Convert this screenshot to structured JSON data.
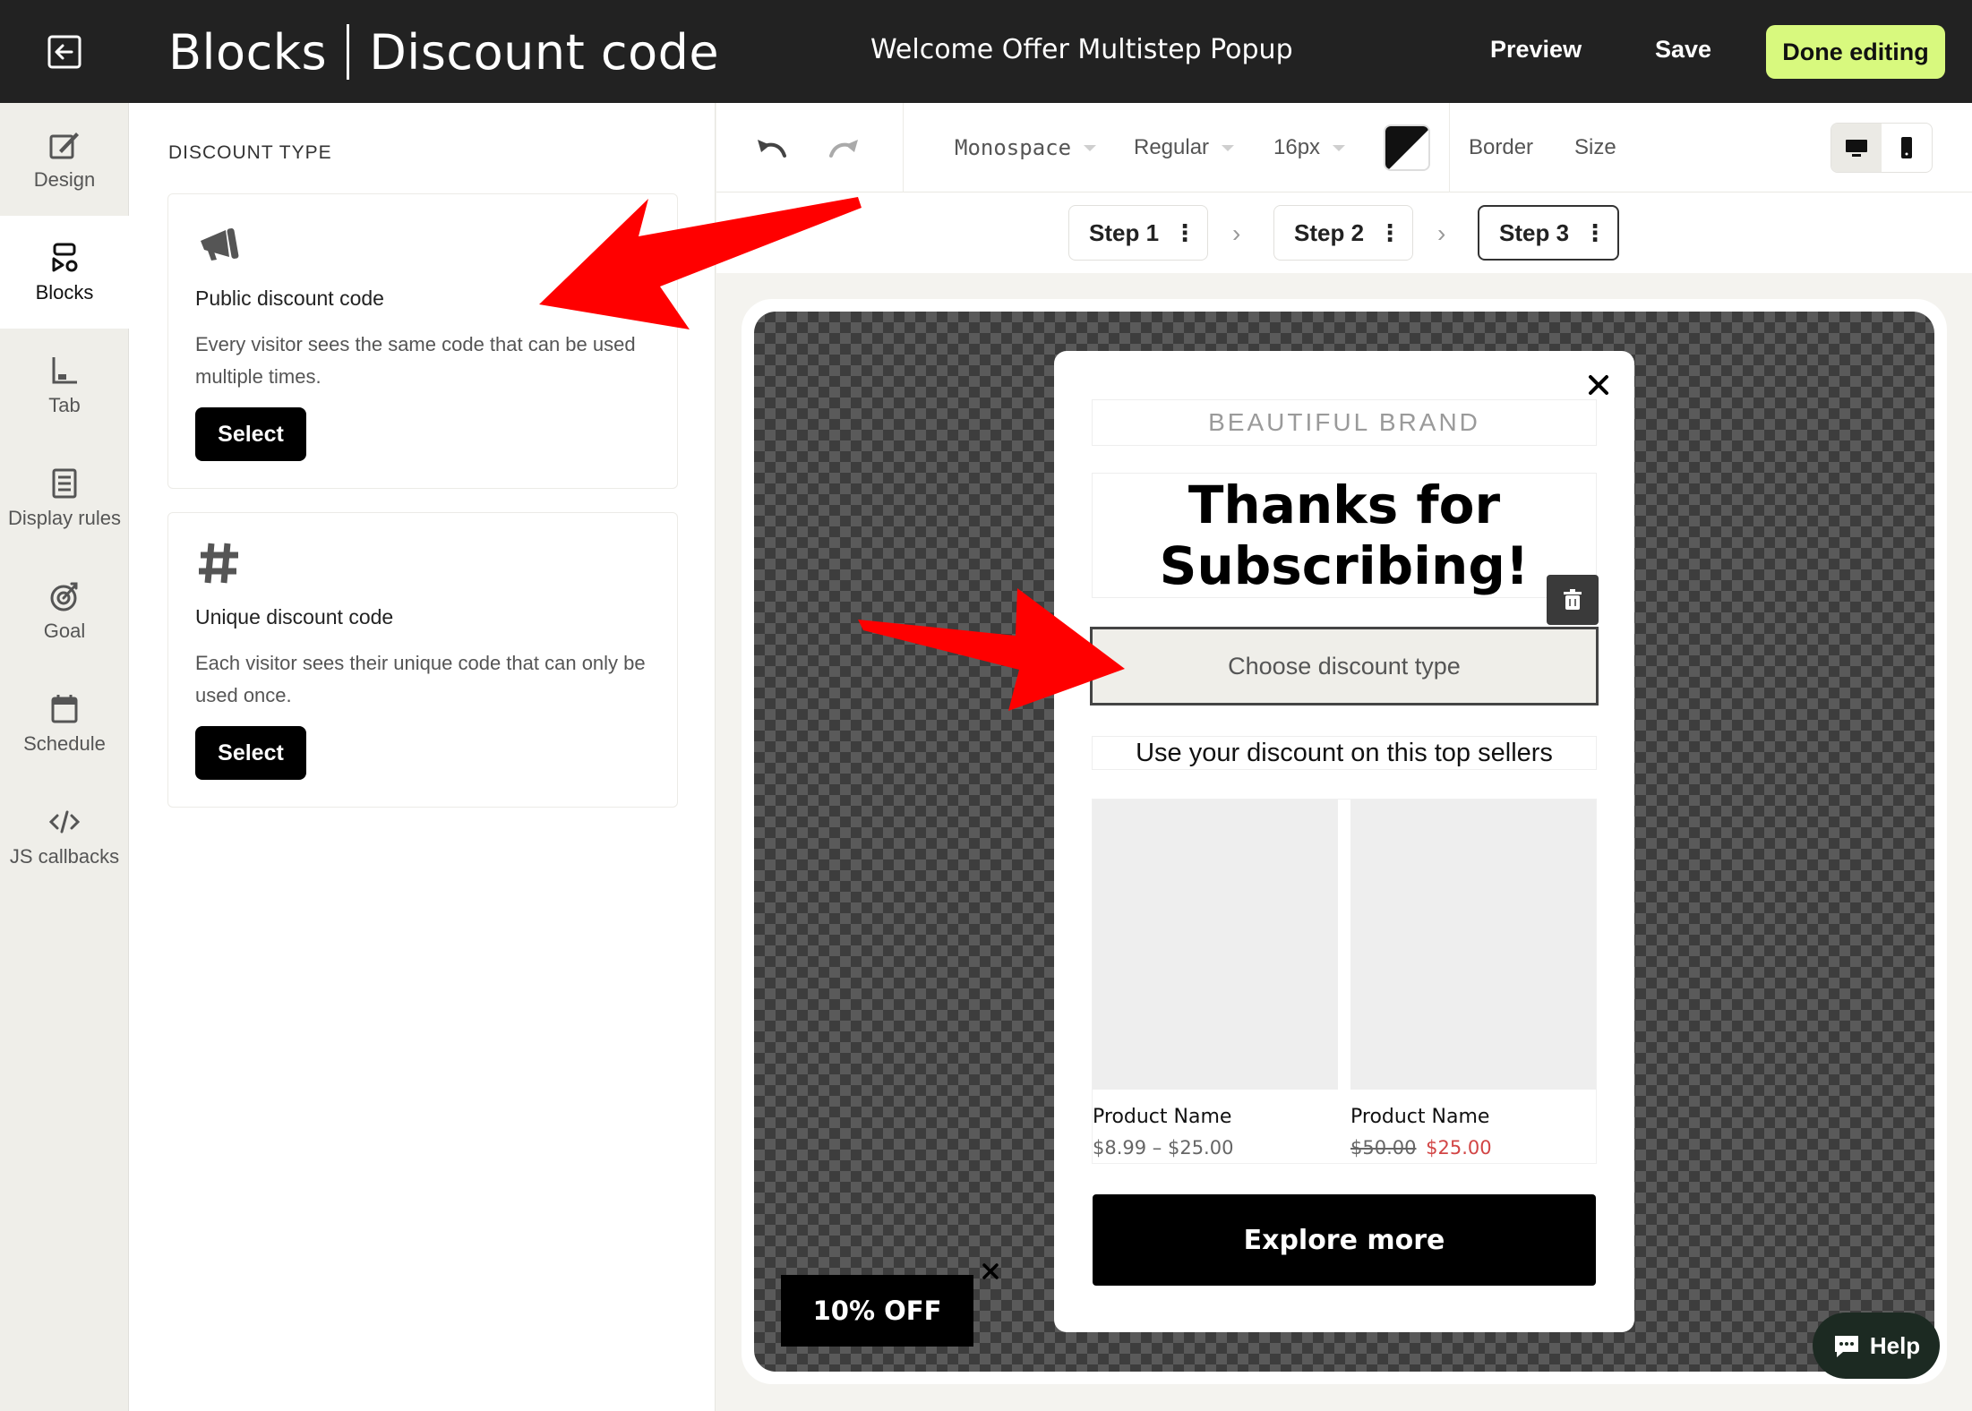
{
  "header": {
    "title_left": "Blocks",
    "title_right": "Discount code",
    "popup_name": "Welcome Offer Multistep Popup",
    "preview_label": "Preview",
    "save_label": "Save",
    "done_label": "Done editing",
    "done_color": "#d8f97e"
  },
  "sidebar": {
    "items": [
      {
        "label": "Design",
        "icon": "brush-icon"
      },
      {
        "label": "Blocks",
        "icon": "blocks-icon",
        "active": true
      },
      {
        "label": "Tab",
        "icon": "tab-icon"
      },
      {
        "label": "Display rules",
        "icon": "document-icon"
      },
      {
        "label": "Goal",
        "icon": "target-icon"
      },
      {
        "label": "Schedule",
        "icon": "calendar-icon"
      },
      {
        "label": "JS callbacks",
        "icon": "code-icon"
      }
    ]
  },
  "panel": {
    "heading": "DISCOUNT TYPE",
    "cards": [
      {
        "icon": "megaphone-icon",
        "title": "Public discount code",
        "description": "Every visitor sees the same code that can be used multiple times.",
        "button": "Select"
      },
      {
        "icon": "hash-icon",
        "title": "Unique discount code",
        "description": "Each visitor sees their unique code that can only be used once.",
        "button": "Select"
      }
    ]
  },
  "toolbar": {
    "font_family": "Monospace",
    "font_weight": "Regular",
    "font_size": "16px",
    "border_label": "Border",
    "size_label": "Size"
  },
  "steps": [
    {
      "label": "Step 1"
    },
    {
      "label": "Step 2"
    },
    {
      "label": "Step 3",
      "current": true
    }
  ],
  "popup": {
    "brand": "BEAUTIFUL BRAND",
    "headline_line1": "Thanks for",
    "headline_line2": "Subscribing!",
    "discount_placeholder": "Choose discount type",
    "subheading": "Use your discount on this top sellers",
    "products": [
      {
        "name": "Product Name",
        "price": "$8.99 – $25.00"
      },
      {
        "name": "Product Name",
        "old_price": "$50.00",
        "new_price": "$25.00"
      }
    ],
    "cta": "Explore more"
  },
  "teaser": {
    "label": "10% OFF"
  },
  "help": {
    "label": "Help"
  },
  "colors": {
    "accent_arrow": "#ff0000",
    "sale_price": "#d24545",
    "topbar_bg": "#222222"
  }
}
